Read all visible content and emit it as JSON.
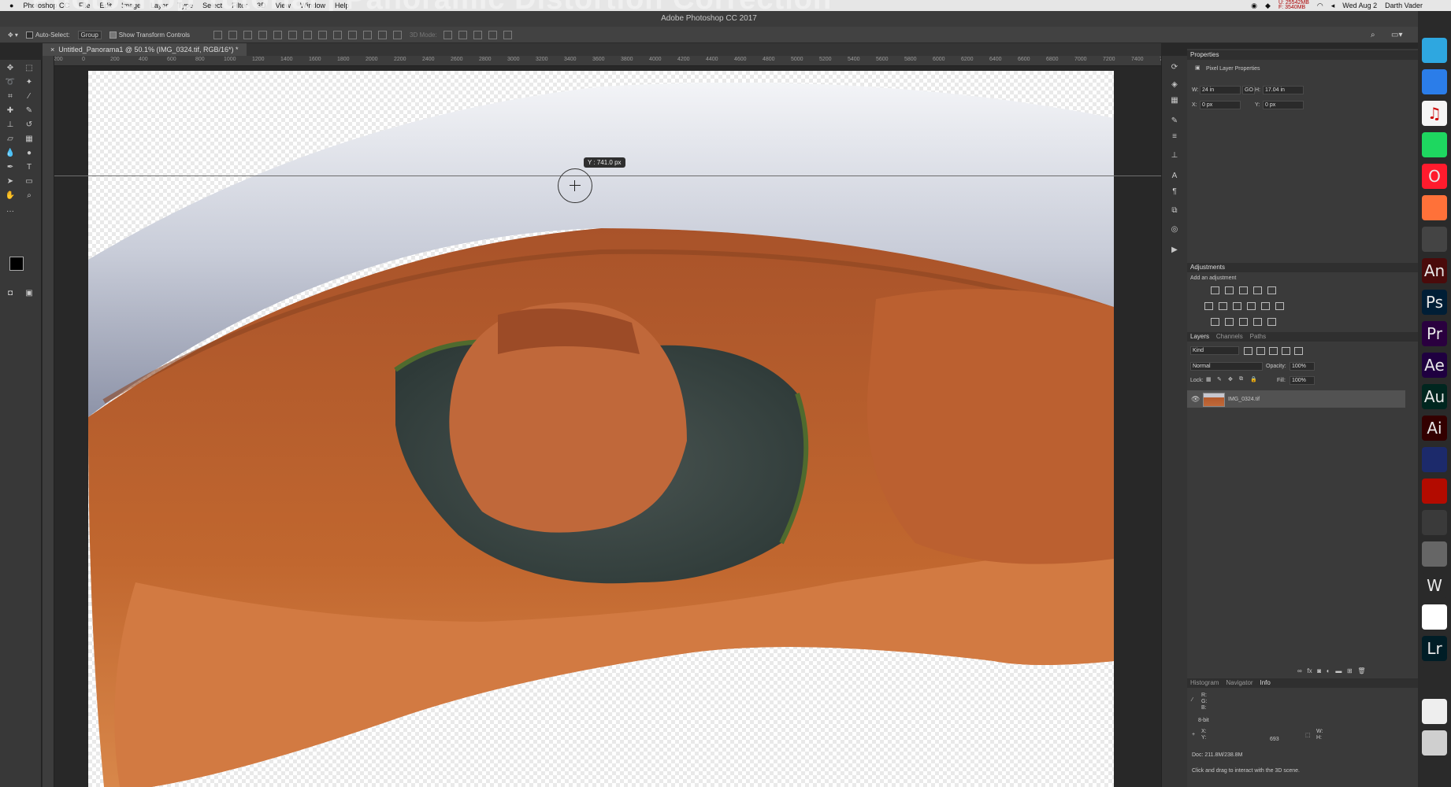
{
  "menubar": {
    "overlay_title": "Photoshop Tutorial | Panoramic Distortion Correction",
    "app_menu": "Photoshop CC",
    "menus": [
      "File",
      "Edit",
      "Image",
      "Layer",
      "Type",
      "Select",
      "Filter",
      "3D",
      "View",
      "Window",
      "Help"
    ],
    "clock": "Wed Aug 2",
    "user": "Darth Vader",
    "mem_a": "U: 25542MB",
    "mem_b": "F: 3540MB"
  },
  "app_title": "Adobe Photoshop CC 2017",
  "options_bar": {
    "auto_select_label": "Auto-Select:",
    "auto_select_mode": "Group",
    "show_transform_label": "Show Transform Controls",
    "mode_3d": "3D Mode:"
  },
  "document": {
    "tab_title": "Untitled_Panorama1 @ 50.1% (IMG_0324.tif, RGB/16*) *",
    "tooltip": "Y : 741.0 px"
  },
  "ruler_ticks": [
    "200",
    "0",
    "200",
    "400",
    "600",
    "800",
    "1000",
    "1200",
    "1400",
    "1600",
    "1800",
    "2000",
    "2200",
    "2400",
    "2600",
    "2800",
    "3000",
    "3200",
    "3400",
    "3600",
    "3800",
    "4000",
    "4200",
    "4400",
    "4600",
    "4800",
    "5000",
    "5200",
    "5400",
    "5600",
    "5800",
    "6000",
    "6200",
    "6400",
    "6600",
    "6800",
    "7000",
    "7200",
    "7400",
    "7600",
    "760"
  ],
  "properties": {
    "title": "Properties",
    "subtitle": "Pixel Layer Properties",
    "w_label": "W:",
    "w_value": "24 in",
    "h_label": "H:",
    "h_value": "17.04 in",
    "x_label": "X:",
    "x_value": "0 px",
    "y_label": "Y:",
    "y_value": "0 px",
    "link_label": "GO"
  },
  "adjustments": {
    "title": "Adjustments",
    "subtitle": "Add an adjustment"
  },
  "layers": {
    "tabs": [
      "Layers",
      "Channels",
      "Paths"
    ],
    "filter_kind": "Kind",
    "blend_mode": "Normal",
    "opacity_label": "Opacity:",
    "opacity_value": "100%",
    "lock_label": "Lock:",
    "fill_label": "Fill:",
    "fill_value": "100%",
    "layer_name": "IMG_0324.tif"
  },
  "info": {
    "tabs": [
      "Histogram",
      "Navigator",
      "Info"
    ],
    "r": "R:",
    "g": "G:",
    "b": "B:",
    "bit": "8-bit",
    "x": "X:",
    "y": "Y:",
    "x_val": "693",
    "w": "W:",
    "h": "H:",
    "doc": "Doc: 211.8M/238.8M",
    "hint": "Click and drag to interact with the 3D scene."
  },
  "dock_apps": [
    {
      "label": "",
      "bg": "#2ea7e0",
      "icon": "messages-icon"
    },
    {
      "label": "",
      "bg": "#2b7de9",
      "icon": "finder-icon"
    },
    {
      "label": "♫",
      "bg": "#f5f5f5",
      "icon": "itunes-icon"
    },
    {
      "label": "",
      "bg": "#1ed760",
      "icon": "spotify-icon"
    },
    {
      "label": "O",
      "bg": "#ff1b2d",
      "icon": "opera-icon"
    },
    {
      "label": "",
      "bg": "#ff7139",
      "icon": "firefox-icon"
    },
    {
      "label": "",
      "bg": "#444444",
      "icon": "clapper-icon"
    },
    {
      "label": "An",
      "bg": "#4a0b0b",
      "icon": "animate-icon"
    },
    {
      "label": "Ps",
      "bg": "#001e36",
      "icon": "photoshop-icon"
    },
    {
      "label": "Pr",
      "bg": "#2a003f",
      "icon": "premiere-icon"
    },
    {
      "label": "Ae",
      "bg": "#1f0040",
      "icon": "after-effects-icon"
    },
    {
      "label": "Au",
      "bg": "#00261f",
      "icon": "audition-icon"
    },
    {
      "label": "Ai",
      "bg": "#330000",
      "icon": "illustrator-icon"
    },
    {
      "label": "",
      "bg": "#1c2a6b",
      "icon": "media-encoder-icon"
    },
    {
      "label": "",
      "bg": "#b30b00",
      "icon": "acrobat-icon"
    },
    {
      "label": "",
      "bg": "#3a3a3a",
      "icon": "pineapple-icon"
    },
    {
      "label": "",
      "bg": "#666666",
      "icon": "system-preferences-icon"
    },
    {
      "label": "W",
      "bg": "#2a2a2a",
      "icon": "word-icon"
    },
    {
      "label": "",
      "bg": "#ffffff",
      "icon": "chrome-icon"
    },
    {
      "label": "Lr",
      "bg": "#001d26",
      "icon": "lightroom-icon"
    },
    {
      "label": "",
      "bg": "#2a2a2a",
      "icon": "quicktime-icon"
    },
    {
      "label": "",
      "bg": "#eeeeee",
      "icon": "document-icon"
    },
    {
      "label": "",
      "bg": "#cfcfcf",
      "icon": "trash-icon"
    }
  ]
}
